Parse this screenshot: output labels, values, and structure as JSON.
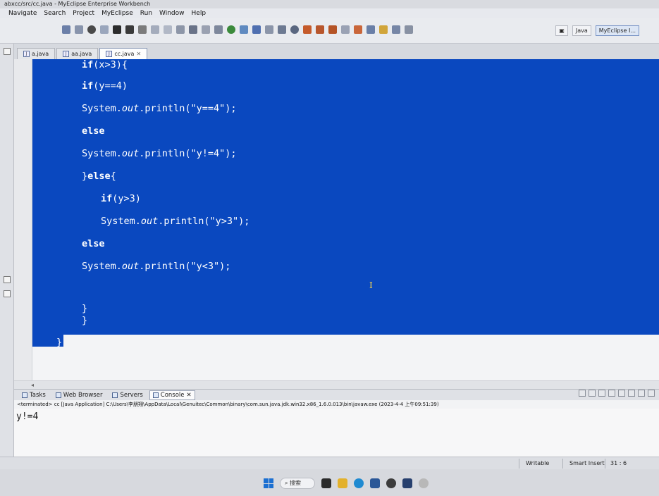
{
  "window": {
    "title": "abxcc/src/cc.java - MyEclipse Enterprise Workbench"
  },
  "menu": [
    "Navigate",
    "Search",
    "Project",
    "MyEclipse",
    "Run",
    "Window",
    "Help"
  ],
  "perspectives": {
    "java": "Java",
    "myeclipse": "MyEclipse I..."
  },
  "editor_tabs": [
    {
      "label": "a.java",
      "active": false
    },
    {
      "label": "aa.java",
      "active": false
    },
    {
      "label": "cc.java",
      "active": true
    }
  ],
  "code": [
    {
      "indent": 0,
      "kw": "if",
      "rest": "(x>3){"
    },
    {
      "indent": 0,
      "kw": "if",
      "rest": "(y==4)"
    },
    {
      "indent": 0,
      "pre": "System.",
      "ital": "out",
      "post": ".println(\"y==4\");"
    },
    {
      "indent": 0,
      "kw": "else",
      "rest": ""
    },
    {
      "indent": 0,
      "pre": "System.",
      "ital": "out",
      "post": ".println(\"y!=4\");"
    },
    {
      "indent": 0,
      "pre2": "}",
      "kw": "else",
      "rest": "{"
    },
    {
      "indent": 1,
      "kw": "if",
      "rest": "(y>3)"
    },
    {
      "indent": 1,
      "pre": "System.",
      "ital": "out",
      "post": ".println(\"y>3\");"
    },
    {
      "indent": 0,
      "kw": "else",
      "rest": ""
    },
    {
      "indent": 0,
      "pre": "System.",
      "ital": "out",
      "post": ".println(\"y<3\");"
    },
    {
      "indent": 0,
      "plain": "}"
    },
    {
      "indent": 0,
      "plain": "}"
    },
    {
      "indent": -1,
      "plain": "}"
    }
  ],
  "console": {
    "tabs": [
      "Tasks",
      "Web Browser",
      "Servers",
      "Console"
    ],
    "active_tab": "Console",
    "terminated_line": "<terminated> cc [Java Application] C:\\Users\\李朋翔\\AppData\\Local\\Genuitec\\Common\\binary\\com.sun.java.jdk.win32.x86_1.6.0.013\\bin\\javaw.exe (2023-4-4 上午09:51:39)",
    "output": "y!=4"
  },
  "status": {
    "writable": "Writable",
    "insert_mode": "Smart Insert",
    "position": "31 : 6"
  },
  "taskbar": {
    "search_label": "搜索"
  }
}
